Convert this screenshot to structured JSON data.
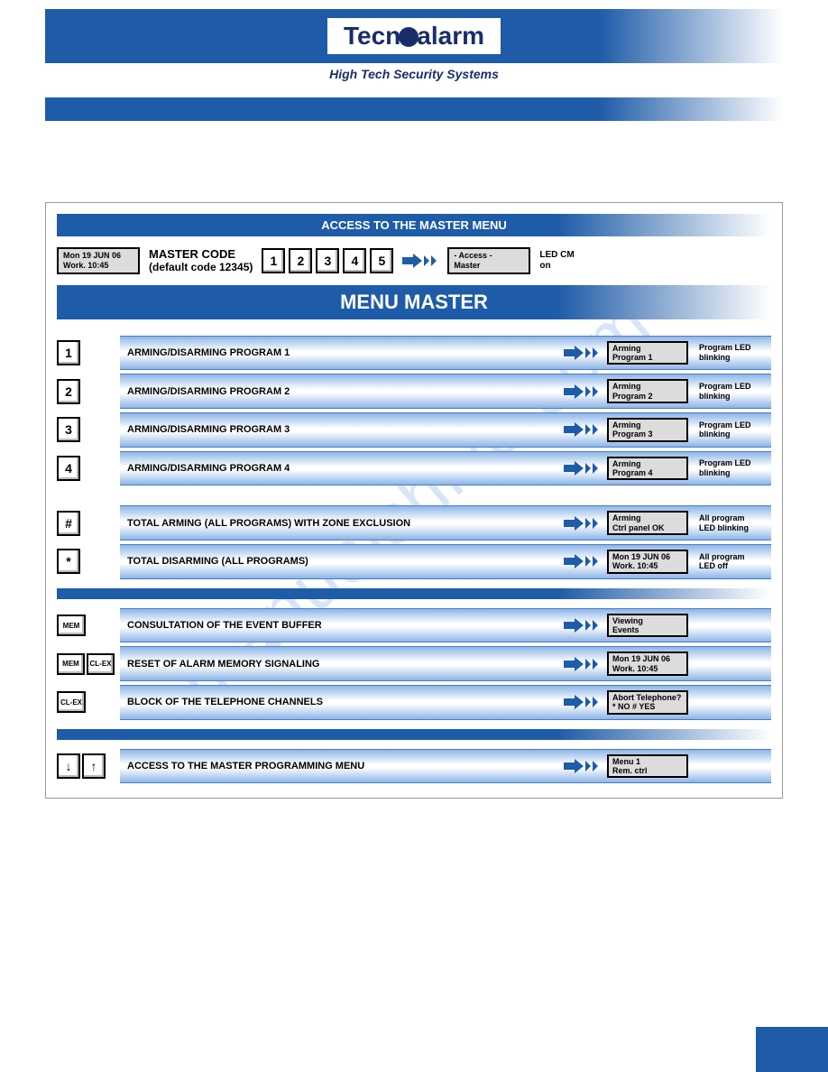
{
  "brand": {
    "name_left": "Tecn",
    "name_right": "alarm",
    "tagline": "High Tech Security Systems"
  },
  "watermark": "manualshive.com",
  "access_section": {
    "title": "ACCESS TO THE MASTER MENU",
    "lcd_line1": "Mon   19 JUN 06",
    "lcd_line2": "Work.    10:45",
    "code_label": "MASTER CODE",
    "code_sub": "(default code 12345)",
    "keys": [
      "1",
      "2",
      "3",
      "4",
      "5"
    ],
    "result_lcd_line1": "- Access -",
    "result_lcd_line2": "Master",
    "status_line1": "LED CM",
    "status_line2": "on"
  },
  "menu_title": "MENU MASTER",
  "group1": [
    {
      "key": "1",
      "label": "ARMING/DISARMING PROGRAM 1",
      "lcd1": "Arming",
      "lcd2": "Program 1",
      "status1": "Program LED",
      "status2": "blinking"
    },
    {
      "key": "2",
      "label": "ARMING/DISARMING PROGRAM 2",
      "lcd1": "Arming",
      "lcd2": "Program 2",
      "status1": "Program LED",
      "status2": "blinking"
    },
    {
      "key": "3",
      "label": "ARMING/DISARMING PROGRAM 3",
      "lcd1": "Arming",
      "lcd2": "Program 3",
      "status1": "Program LED",
      "status2": "blinking"
    },
    {
      "key": "4",
      "label": "ARMING/DISARMING PROGRAM 4",
      "lcd1": "Arming",
      "lcd2": "Program 4",
      "status1": "Program LED",
      "status2": "blinking"
    }
  ],
  "group2": [
    {
      "key": "#",
      "label": "TOTAL ARMING (ALL PROGRAMS) WITH ZONE EXCLUSION",
      "lcd1": "Arming",
      "lcd2": "Ctrl panel OK",
      "status1": "All program",
      "status2": "LED blinking"
    },
    {
      "key": "*",
      "label": "TOTAL DISARMING (ALL PROGRAMS)",
      "lcd1": "Mon   19 JUN 06",
      "lcd2": "Work.    10:45",
      "status1": "All program",
      "status2": "LED off"
    }
  ],
  "group3": [
    {
      "keys": [
        "MEM"
      ],
      "label": "CONSULTATION OF THE EVENT BUFFER",
      "lcd1": "Viewing",
      "lcd2": "Events",
      "status1": "",
      "status2": ""
    },
    {
      "keys": [
        "MEM",
        "CL-EX"
      ],
      "label": "RESET OF ALARM MEMORY SIGNALING",
      "lcd1": "Mon   19 JUN 06",
      "lcd2": "Work.    10:45",
      "status1": "",
      "status2": ""
    },
    {
      "keys": [
        "CL-EX"
      ],
      "label": "BLOCK OF THE TELEPHONE CHANNELS",
      "lcd1": "Abort Telephone?",
      "lcd2": "* NO   # YES",
      "status1": "",
      "status2": ""
    }
  ],
  "group4": [
    {
      "keys": [
        "↓",
        "↑"
      ],
      "label": "ACCESS TO THE MASTER PROGRAMMING MENU",
      "lcd1": "Menu              1",
      "lcd2": "Rem. ctrl",
      "status1": "",
      "status2": ""
    }
  ]
}
